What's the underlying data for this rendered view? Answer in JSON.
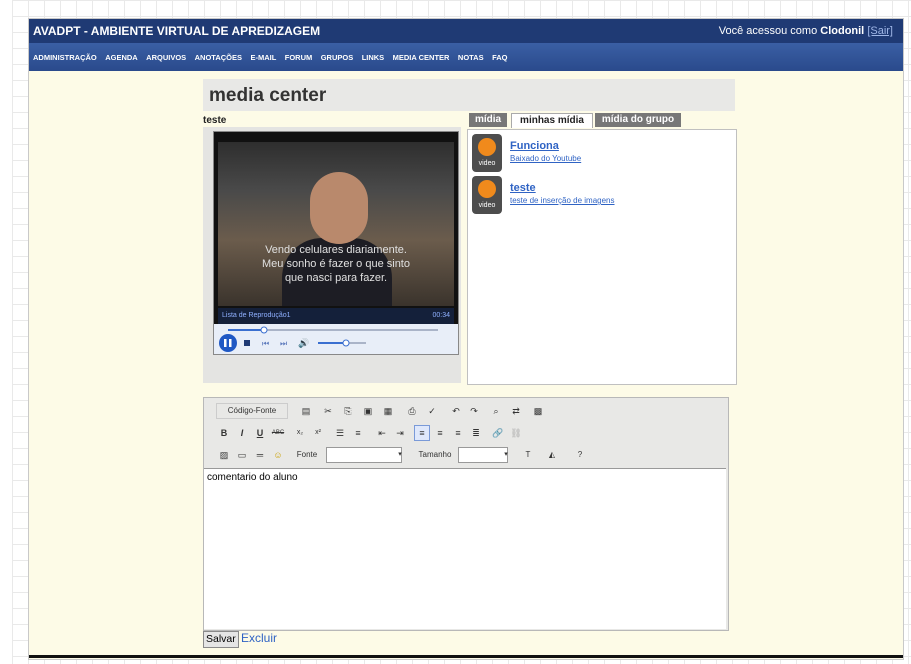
{
  "header": {
    "app_title": "AVADPT - AMBIENTE VIRTUAL DE APREDIZAGEM",
    "user_prefix": "Você acessou como",
    "user_name": "Clodonil",
    "logout": "[Sair]"
  },
  "menu": [
    "ADMINISTRAÇÃO",
    "AGENDA",
    "ARQUIVOS",
    "ANOTAÇÕES",
    "E-MAIL",
    "FORUM",
    "GRUPOS",
    "LINKS",
    "MEDIA CENTER",
    "NOTAS",
    "FAQ"
  ],
  "page": {
    "title": "media center",
    "media_title": "teste"
  },
  "player": {
    "subtitle_lines": [
      "Vendo celulares diariamente.",
      "Meu sonho é fazer o que sinto",
      "que nasci para fazer."
    ],
    "playlist_label": "Lista de Reprodução1",
    "time": "00:34"
  },
  "tabs": [
    {
      "label": "mídia",
      "active": false
    },
    {
      "label": "minhas mídia",
      "active": true
    },
    {
      "label": "mídia do grupo",
      "active": false
    }
  ],
  "media_items": [
    {
      "name": "Funciona",
      "description": "Baixado do Youtube",
      "type": "video"
    },
    {
      "name": "teste",
      "description": "teste de inserção de imagens",
      "type": "video"
    }
  ],
  "editor": {
    "source_label": "Código-Fonte",
    "font_label": "Fonte",
    "size_label": "Tamanho",
    "content": "comentario do aluno"
  },
  "actions": {
    "save": "Salvar",
    "delete": "Excluir"
  }
}
